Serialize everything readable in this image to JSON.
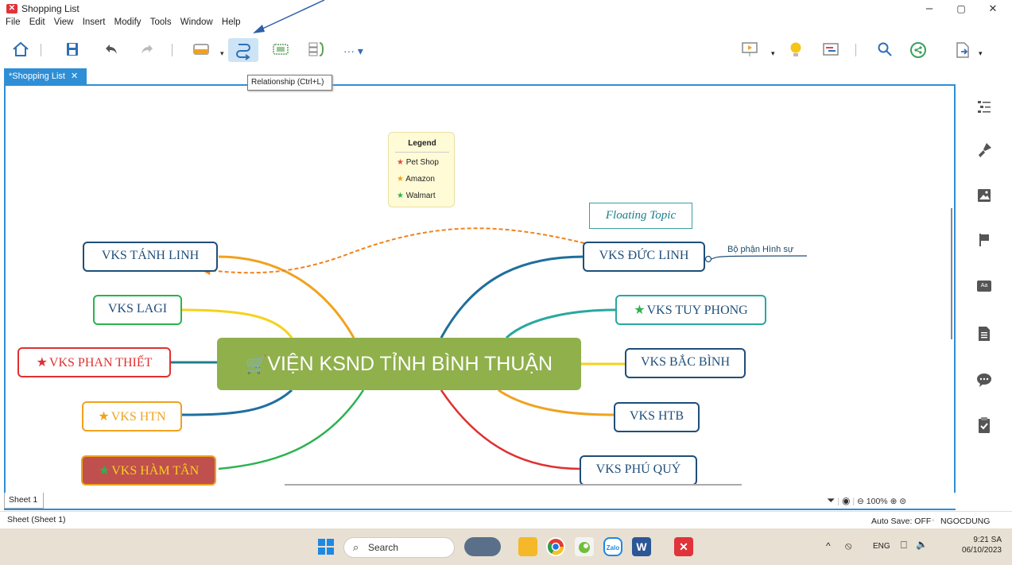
{
  "window": {
    "title": "Shopping List",
    "minimize": "–",
    "restore": "▢",
    "close": "✕"
  },
  "menu": [
    "File",
    "Edit",
    "View",
    "Insert",
    "Modify",
    "Tools",
    "Window",
    "Help"
  ],
  "toolbar": {
    "more": "··· ▾",
    "home_icon": "home-icon",
    "save_icon": "save-icon",
    "undo_icon": "undo-icon",
    "redo_icon": "redo-icon",
    "topic_icon": "topic-icon",
    "relationship_icon": "relationship-icon",
    "boundary_icon": "boundary-icon",
    "summary_icon": "summary-icon",
    "presentation_icon": "presentation-icon",
    "idea_icon": "lightbulb-icon",
    "gantt_icon": "gantt-icon",
    "search_icon": "search-icon",
    "share_icon": "share-icon",
    "export_icon": "export-icon"
  },
  "tab": {
    "label": "*Shopping List",
    "close": "✕"
  },
  "tooltip": "Relationship (Ctrl+L)",
  "legend": {
    "title": "Legend",
    "items": [
      {
        "label": "Pet Shop",
        "color": "#e04848"
      },
      {
        "label": "Amazon",
        "color": "#f0a21e"
      },
      {
        "label": "Walmart",
        "color": "#2bb34f"
      }
    ]
  },
  "mindmap": {
    "central": {
      "icon": "cart-icon",
      "text": "VIỆN KSND TỈNH BÌNH THUẬN"
    },
    "floating_topic": "Floating Topic",
    "subtopic": "Bộ phận Hình sự",
    "left_topics": [
      {
        "text": "VKS TÁNH LINH",
        "star": "",
        "color": "#1f4e79"
      },
      {
        "text": "VKS LAGI",
        "star": "",
        "color": "#2bb34f"
      },
      {
        "text": "VKS PHAN THIẾT",
        "star": "★",
        "color": "#e03030"
      },
      {
        "text": "VKS HTN",
        "star": "★",
        "color": "#f0a21e"
      },
      {
        "text": "VKS HÀM TÂN",
        "star": "★",
        "color": "#f0a21e"
      }
    ],
    "right_topics": [
      {
        "text": "VKS ĐỨC LINH",
        "star": "",
        "color": "#1f4e79"
      },
      {
        "text": "VKS TUY PHONG",
        "star": "★",
        "color": "#1f4e79"
      },
      {
        "text": "VKS BẮC BÌNH",
        "star": "",
        "color": "#1f4e79"
      },
      {
        "text": "VKS HTB",
        "star": "",
        "color": "#1f4e79"
      },
      {
        "text": "VKS PHÚ QUÝ",
        "star": "",
        "color": "#1f4e79"
      }
    ]
  },
  "sidebar": [
    "outline-icon",
    "format-painter-icon",
    "image-icon",
    "flag-icon",
    "text-style-icon",
    "notes-icon",
    "comments-icon",
    "task-icon"
  ],
  "sheet": {
    "tab": "Sheet 1",
    "zoom": "100%"
  },
  "status": {
    "left": "Sheet (Sheet 1)",
    "autosave": "Auto Save: OFF",
    "user": "NGOCDUNG"
  },
  "taskbar": {
    "search": "Search",
    "lang": "ENG",
    "time": "9:21 SA",
    "date": "06/10/2023"
  }
}
